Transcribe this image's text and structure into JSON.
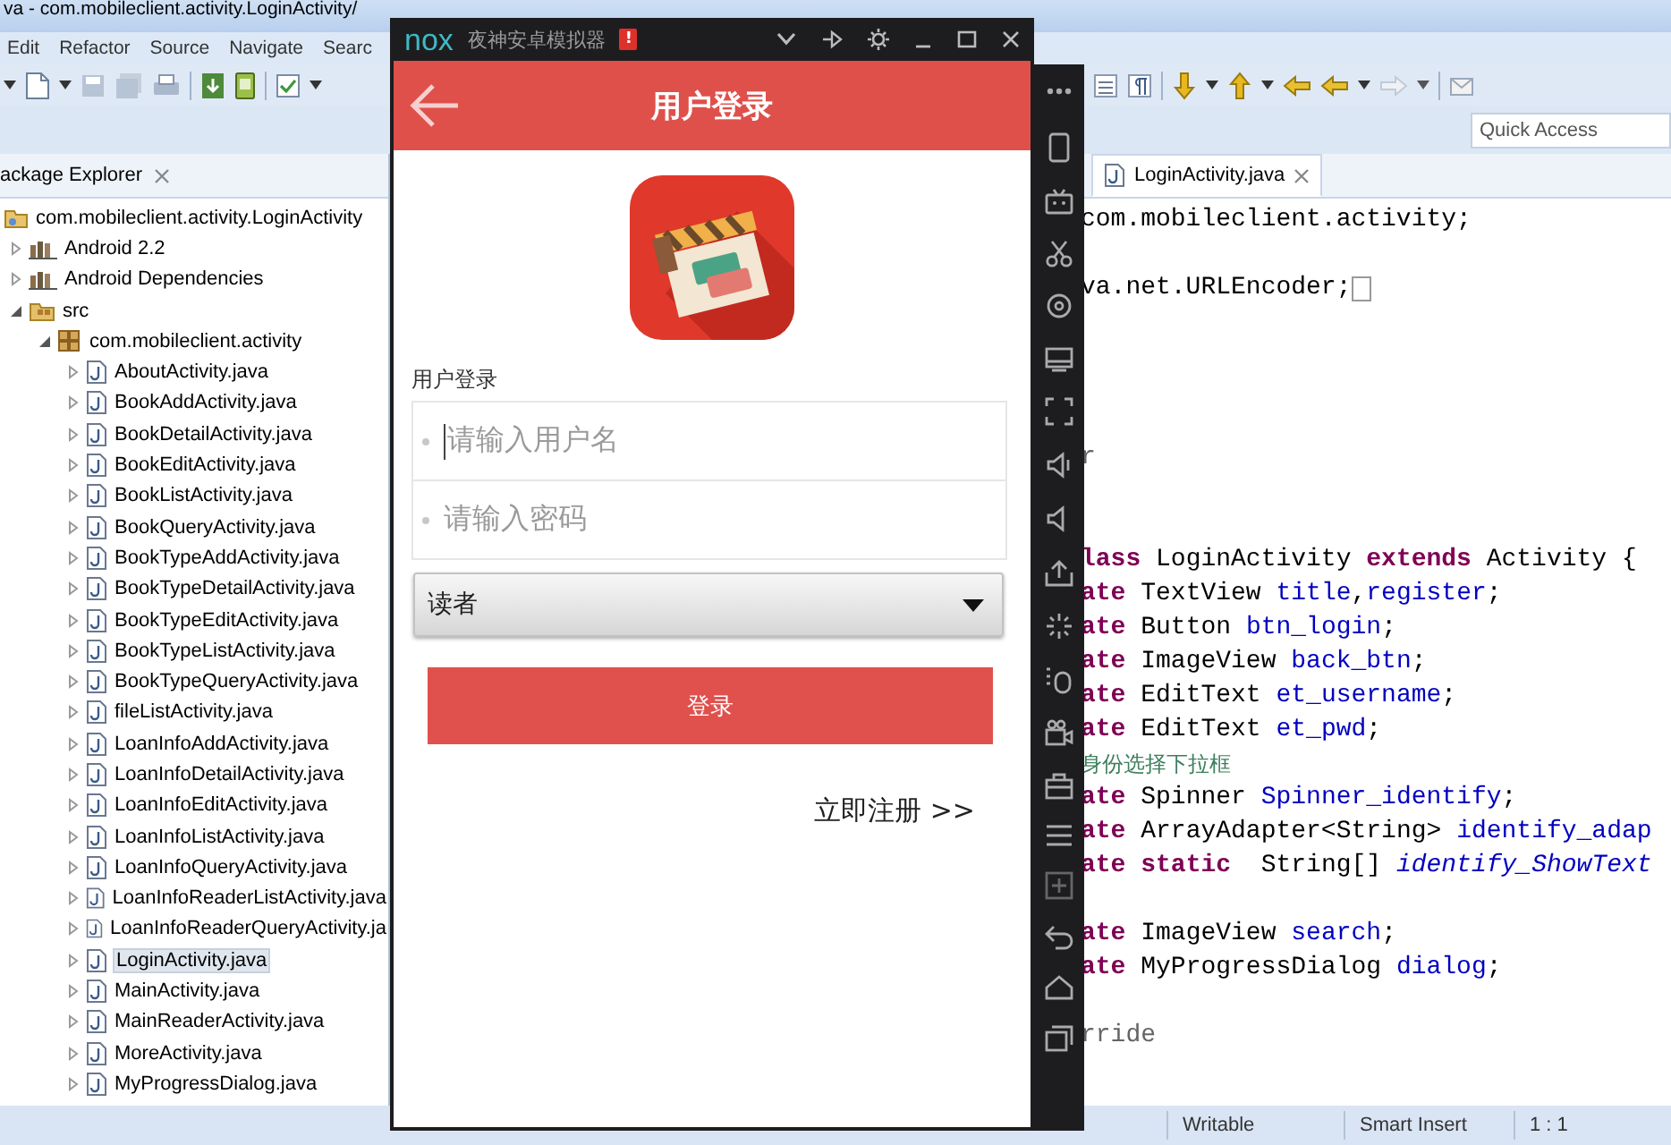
{
  "ide": {
    "title": "va - com.mobileclient.activity.LoginActivity/",
    "menu": [
      {
        "label": "Edit"
      },
      {
        "label": "Refactor"
      },
      {
        "label": "Source"
      },
      {
        "label": "Navigate"
      },
      {
        "label": "Searc"
      }
    ],
    "quick_access": {
      "placeholder": "Quick Access"
    },
    "explorer": {
      "title": "ackage Explorer",
      "tree": [
        {
          "label": "com.mobileclient.activity.LoginActivity",
          "kind": "project",
          "selected": false,
          "children": [
            {
              "label": "Android 2.2",
              "kind": "library",
              "expanded": false,
              "selected": false
            },
            {
              "label": "Android Dependencies",
              "kind": "library",
              "expanded": false,
              "selected": false
            },
            {
              "label": "src",
              "kind": "folder",
              "expanded": true,
              "selected": false,
              "children": [
                {
                  "label": "com.mobileclient.activity",
                  "kind": "package",
                  "expanded": true,
                  "selected": false,
                  "children": [
                    {
                      "label": "AboutActivity.java",
                      "kind": "file",
                      "expanded": false,
                      "selected": false
                    },
                    {
                      "label": "BookAddActivity.java",
                      "kind": "file",
                      "expanded": false,
                      "selected": false
                    },
                    {
                      "label": "BookDetailActivity.java",
                      "kind": "file",
                      "expanded": false,
                      "selected": false
                    },
                    {
                      "label": "BookEditActivity.java",
                      "kind": "file",
                      "expanded": false,
                      "selected": false
                    },
                    {
                      "label": "BookListActivity.java",
                      "kind": "file",
                      "expanded": false,
                      "selected": false
                    },
                    {
                      "label": "BookQueryActivity.java",
                      "kind": "file",
                      "expanded": false,
                      "selected": false
                    },
                    {
                      "label": "BookTypeAddActivity.java",
                      "kind": "file",
                      "expanded": false,
                      "selected": false
                    },
                    {
                      "label": "BookTypeDetailActivity.java",
                      "kind": "file",
                      "expanded": false,
                      "selected": false
                    },
                    {
                      "label": "BookTypeEditActivity.java",
                      "kind": "file",
                      "expanded": false,
                      "selected": false
                    },
                    {
                      "label": "BookTypeListActivity.java",
                      "kind": "file",
                      "expanded": false,
                      "selected": false
                    },
                    {
                      "label": "BookTypeQueryActivity.java",
                      "kind": "file",
                      "expanded": false,
                      "selected": false
                    },
                    {
                      "label": "fileListActivity.java",
                      "kind": "file",
                      "expanded": false,
                      "selected": false
                    },
                    {
                      "label": "LoanInfoAddActivity.java",
                      "kind": "file",
                      "expanded": false,
                      "selected": false
                    },
                    {
                      "label": "LoanInfoDetailActivity.java",
                      "kind": "file",
                      "expanded": false,
                      "selected": false
                    },
                    {
                      "label": "LoanInfoEditActivity.java",
                      "kind": "file",
                      "expanded": false,
                      "selected": false
                    },
                    {
                      "label": "LoanInfoListActivity.java",
                      "kind": "file",
                      "expanded": false,
                      "selected": false
                    },
                    {
                      "label": "LoanInfoQueryActivity.java",
                      "kind": "file",
                      "expanded": false,
                      "selected": false
                    },
                    {
                      "label": "LoanInfoReaderListActivity.java",
                      "kind": "file",
                      "expanded": false,
                      "selected": false
                    },
                    {
                      "label": "LoanInfoReaderQueryActivity.ja",
                      "kind": "file",
                      "expanded": false,
                      "selected": false
                    },
                    {
                      "label": "LoginActivity.java",
                      "kind": "file",
                      "expanded": false,
                      "selected": true
                    },
                    {
                      "label": "MainActivity.java",
                      "kind": "file",
                      "expanded": false,
                      "selected": false
                    },
                    {
                      "label": "MainReaderActivity.java",
                      "kind": "file",
                      "expanded": false,
                      "selected": false
                    },
                    {
                      "label": "MoreActivity.java",
                      "kind": "file",
                      "expanded": false,
                      "selected": false
                    },
                    {
                      "label": "MyProgressDialog.java",
                      "kind": "file",
                      "expanded": false,
                      "selected": false
                    }
                  ]
                }
              ]
            }
          ]
        }
      ]
    },
    "editor": {
      "tabs": [
        {
          "label": "LoginActivity.java",
          "selected": true
        }
      ],
      "lines": [
        {
          "kind": "code",
          "folded": false,
          "tokens": [
            {
              "text": "com.mobileclient.activity;",
              "kind": "plain"
            }
          ]
        },
        {
          "kind": "blank"
        },
        {
          "kind": "code",
          "folded": true,
          "tokens": [
            {
              "text": "va.net.URLEncoder;",
              "kind": "plain"
            }
          ]
        },
        {
          "kind": "blank"
        },
        {
          "kind": "blank"
        },
        {
          "kind": "blank"
        },
        {
          "kind": "blank"
        },
        {
          "kind": "code",
          "folded": false,
          "tokens": [
            {
              "text": "r",
              "kind": "annotation"
            }
          ]
        },
        {
          "kind": "blank"
        },
        {
          "kind": "blank"
        },
        {
          "kind": "code",
          "folded": false,
          "tokens": [
            {
              "text": "lass",
              "kind": "keyword"
            },
            {
              "text": " LoginActivity ",
              "kind": "plain"
            },
            {
              "text": "extends",
              "kind": "keyword"
            },
            {
              "text": " Activity {",
              "kind": "plain"
            }
          ]
        },
        {
          "kind": "code",
          "folded": false,
          "tokens": [
            {
              "text": "ate",
              "kind": "keyword"
            },
            {
              "text": " TextView ",
              "kind": "plain"
            },
            {
              "text": "title",
              "kind": "field"
            },
            {
              "text": ",",
              "kind": "plain"
            },
            {
              "text": "register",
              "kind": "field"
            },
            {
              "text": ";",
              "kind": "plain"
            }
          ]
        },
        {
          "kind": "code",
          "folded": false,
          "tokens": [
            {
              "text": "ate",
              "kind": "keyword"
            },
            {
              "text": " Button ",
              "kind": "plain"
            },
            {
              "text": "btn_login",
              "kind": "field"
            },
            {
              "text": ";",
              "kind": "plain"
            }
          ]
        },
        {
          "kind": "code",
          "folded": false,
          "tokens": [
            {
              "text": "ate",
              "kind": "keyword"
            },
            {
              "text": " ImageView ",
              "kind": "plain"
            },
            {
              "text": "back_btn",
              "kind": "field"
            },
            {
              "text": ";",
              "kind": "plain"
            }
          ]
        },
        {
          "kind": "code",
          "folded": false,
          "tokens": [
            {
              "text": "ate",
              "kind": "keyword"
            },
            {
              "text": " EditText ",
              "kind": "plain"
            },
            {
              "text": "et_username",
              "kind": "field"
            },
            {
              "text": ";",
              "kind": "plain"
            }
          ]
        },
        {
          "kind": "code",
          "folded": false,
          "tokens": [
            {
              "text": "ate",
              "kind": "keyword"
            },
            {
              "text": " EditText ",
              "kind": "plain"
            },
            {
              "text": "et_pwd",
              "kind": "field"
            },
            {
              "text": ";",
              "kind": "plain"
            }
          ]
        },
        {
          "kind": "code",
          "folded": false,
          "tokens": [
            {
              "text": "身份选择下拉框",
              "kind": "comment"
            }
          ]
        },
        {
          "kind": "code",
          "folded": false,
          "tokens": [
            {
              "text": "ate",
              "kind": "keyword"
            },
            {
              "text": " Spinner ",
              "kind": "plain"
            },
            {
              "text": "Spinner_identify",
              "kind": "field"
            },
            {
              "text": ";",
              "kind": "plain"
            }
          ]
        },
        {
          "kind": "code",
          "folded": false,
          "tokens": [
            {
              "text": "ate",
              "kind": "keyword"
            },
            {
              "text": " ArrayAdapter<String> ",
              "kind": "plain"
            },
            {
              "text": "identify_adap",
              "kind": "field"
            }
          ]
        },
        {
          "kind": "code",
          "folded": false,
          "tokens": [
            {
              "text": "ate",
              "kind": "keyword"
            },
            {
              "text": " static",
              "kind": "keyword"
            },
            {
              "text": "  String[] ",
              "kind": "plain"
            },
            {
              "text": "identify_ShowText",
              "kind": "static_field"
            }
          ]
        },
        {
          "kind": "blank"
        },
        {
          "kind": "code",
          "folded": false,
          "tokens": [
            {
              "text": "ate",
              "kind": "keyword"
            },
            {
              "text": " ImageView ",
              "kind": "plain"
            },
            {
              "text": "search",
              "kind": "field"
            },
            {
              "text": ";",
              "kind": "plain"
            }
          ]
        },
        {
          "kind": "code",
          "folded": false,
          "tokens": [
            {
              "text": "ate",
              "kind": "keyword"
            },
            {
              "text": " MyProgressDialog ",
              "kind": "plain"
            },
            {
              "text": "dialog",
              "kind": "field"
            },
            {
              "text": ";",
              "kind": "plain"
            }
          ]
        },
        {
          "kind": "blank"
        },
        {
          "kind": "code",
          "folded": false,
          "tokens": [
            {
              "text": "rride",
              "kind": "annotation"
            }
          ]
        }
      ]
    },
    "status_bar": [
      {
        "text": "Writable"
      },
      {
        "text": "Smart Insert"
      },
      {
        "text": "1 : 1"
      }
    ]
  },
  "emulator": {
    "logo": "nox",
    "title": "夜神安卓模拟器",
    "alert": "!",
    "app": {
      "title": "用户登录",
      "section_label": "用户登录",
      "fields": [
        {
          "placeholder": "请输入用户名",
          "focused": true
        },
        {
          "placeholder": "请输入密码",
          "focused": false
        }
      ],
      "spinner": {
        "value": "读者"
      },
      "login_button": "登录",
      "register_link": "立即注册 >>"
    }
  }
}
